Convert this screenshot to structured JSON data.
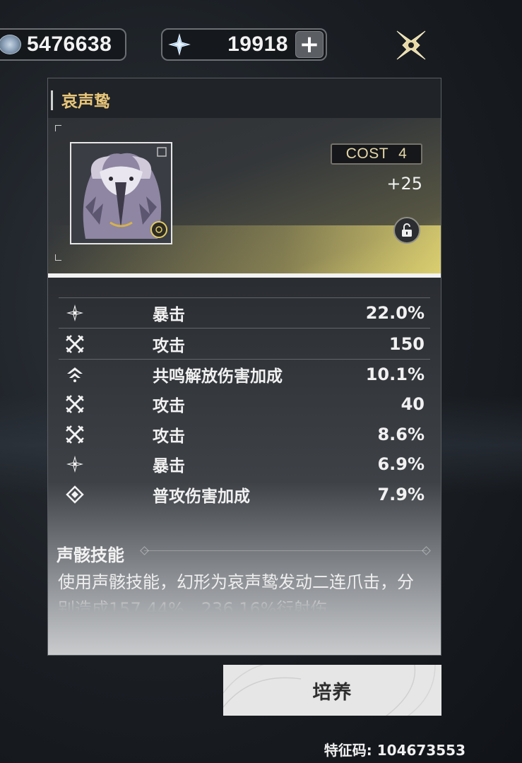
{
  "currencies": {
    "shells": {
      "icon": "shell-credit-icon",
      "value": "5476638"
    },
    "astrite": {
      "icon": "astrite-star-icon",
      "value": "19918",
      "add_label": "+"
    }
  },
  "close_icon": "close-x-icon",
  "echo": {
    "name": "哀声鸷",
    "cost_label": "COST",
    "cost_value": "4",
    "level": "+25",
    "locked": false
  },
  "stats": [
    {
      "icon": "crit-icon",
      "name": "暴击",
      "value": "22.0%"
    },
    {
      "icon": "attack-icon",
      "name": "攻击",
      "value": "150"
    },
    {
      "icon": "resonance-liberation-icon",
      "name": "共鸣解放伤害加成",
      "value": "10.1%"
    },
    {
      "icon": "attack-icon",
      "name": "攻击",
      "value": "40"
    },
    {
      "icon": "attack-icon",
      "name": "攻击",
      "value": "8.6%"
    },
    {
      "icon": "crit-icon",
      "name": "暴击",
      "value": "6.9%"
    },
    {
      "icon": "basic-attack-icon",
      "name": "普攻伤害加成",
      "value": "7.9%"
    }
  ],
  "skill": {
    "title": "声骸技能",
    "description": "使用声骸技能，幻形为哀声鸷发动二连爪击，分别造成157.44%、236.16%衍射伤"
  },
  "actions": {
    "train_label": "培养"
  },
  "feature_code": "特征码: 104673553",
  "colors": {
    "title_gold": "#e9c77a",
    "hero_glow": "#e8dc7a"
  }
}
